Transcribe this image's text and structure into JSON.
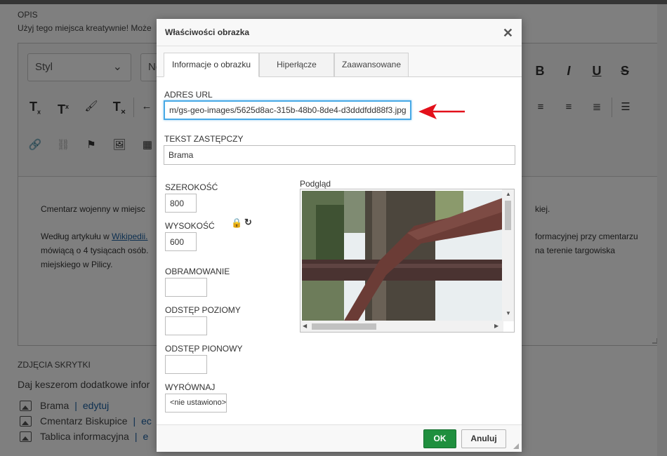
{
  "page": {
    "opis_label": "OPIS",
    "opis_hint": "Użyj tego miejsca kreatywnie! Może",
    "editor": {
      "style_combo": "Styl",
      "format_combo": "No",
      "paragraph1": "Cmentarz wojenny w miejsc",
      "paragraph1_tail": "kiej.",
      "paragraph2_line1_start": "Według artykułu w ",
      "paragraph2_link": "Wikipedii.",
      "paragraph2_line1_tail": "formacyjnej przy cmentarzu",
      "paragraph2_line2": "mówiącą o 4 tysiącach osób.",
      "paragraph2_line2_tail": "na terenie targowiska",
      "paragraph2_line3": "miejskiego w Pilicy."
    },
    "photos_label": "ZDJĘCIA SKRYTKI",
    "photos_hint": "Daj keszerom dodatkowe infor",
    "photos": [
      {
        "name": "Brama",
        "sep": "|",
        "edit": "edytuj"
      },
      {
        "name": "Cmentarz Biskupice",
        "sep": "|",
        "edit": "ec"
      },
      {
        "name": "Tablica informacyjna",
        "sep": "|",
        "edit": "e"
      }
    ]
  },
  "dialog": {
    "title": "Właściwości obrazka",
    "close_glyph": "✕",
    "tabs": [
      {
        "label": "Informacje o obrazku",
        "active": true
      },
      {
        "label": "Hiperłącze",
        "active": false
      },
      {
        "label": "Zaawansowane",
        "active": false
      }
    ],
    "url_label": "ADRES URL",
    "url_value": "m/gs-geo-images/5625d8ac-315b-48b0-8de4-d3dddfdd88f3.jpg",
    "alt_label": "TEKST ZASTĘPCZY",
    "alt_value": "Brama",
    "width_label": "SZEROKOŚĆ",
    "width_value": "800",
    "height_label": "WYSOKOŚĆ",
    "height_value": "600",
    "border_label": "OBRAMOWANIE",
    "border_value": "",
    "hspace_label": "ODSTĘP POZIOMY",
    "hspace_value": "",
    "vspace_label": "ODSTĘP PIONOWY",
    "vspace_value": "",
    "align_label": "WYRÓWNAJ",
    "align_value": "<nie ustawiono>",
    "preview_label": "Podgląd",
    "ok_label": "OK",
    "cancel_label": "Anuluj"
  },
  "colors": {
    "ok_button": "#1f8f3e",
    "focus_border": "#48a9e6",
    "annotation_arrow": "#e3101a",
    "link": "#1b5fa0"
  }
}
